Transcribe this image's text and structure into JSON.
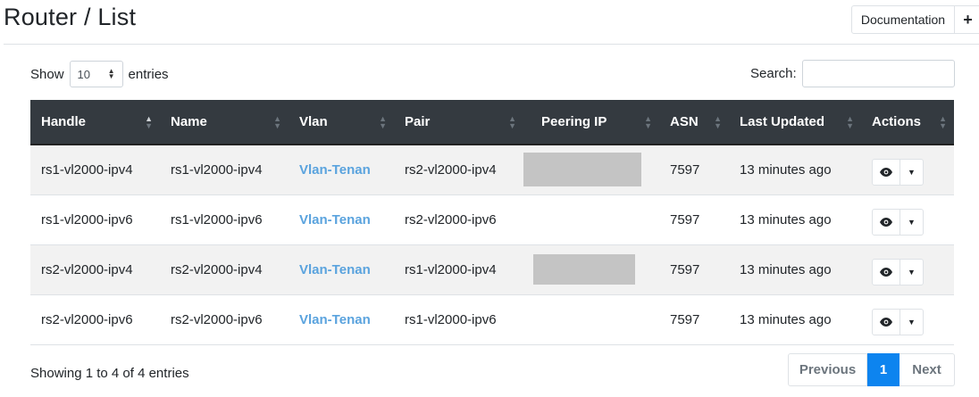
{
  "header": {
    "title": "Router / List",
    "documentation_label": "Documentation",
    "add_icon": "plus-icon"
  },
  "controls": {
    "show_label": "Show",
    "entries_label": "entries",
    "length_value": "10",
    "search_label": "Search:",
    "search_value": ""
  },
  "table": {
    "columns": [
      "Handle",
      "Name",
      "Vlan",
      "Pair",
      "Peering IP",
      "ASN",
      "Last Updated",
      "Actions"
    ],
    "sorted_column": "Handle",
    "rows": [
      {
        "handle": "rs1-vl2000-ipv4",
        "name": "rs1-vl2000-ipv4",
        "vlan": "Vlan-Tenan",
        "pair": "rs2-vl2000-ipv4",
        "peering_ip": "",
        "asn": "7597",
        "updated": "13 minutes ago"
      },
      {
        "handle": "rs1-vl2000-ipv6",
        "name": "rs1-vl2000-ipv6",
        "vlan": "Vlan-Tenan",
        "pair": "rs2-vl2000-ipv6",
        "peering_ip": "",
        "asn": "7597",
        "updated": "13 minutes ago"
      },
      {
        "handle": "rs2-vl2000-ipv4",
        "name": "rs2-vl2000-ipv4",
        "vlan": "Vlan-Tenan",
        "pair": "rs1-vl2000-ipv4",
        "peering_ip": "",
        "asn": "7597",
        "updated": "13 minutes ago"
      },
      {
        "handle": "rs2-vl2000-ipv6",
        "name": "rs2-vl2000-ipv6",
        "vlan": "Vlan-Tenan",
        "pair": "rs1-vl2000-ipv6",
        "peering_ip": "",
        "asn": "7597",
        "updated": "13 minutes ago"
      }
    ],
    "view_icon": "eye-icon",
    "menu_icon": "caret-down-icon"
  },
  "footer": {
    "info": "Showing 1 to 4 of 4 entries",
    "previous_label": "Previous",
    "current_page": "1",
    "next_label": "Next"
  },
  "colors": {
    "header_bg": "#343a40",
    "link": "#5aa3de",
    "active_page": "#0d84ef",
    "redaction": "#c4c4c4"
  }
}
